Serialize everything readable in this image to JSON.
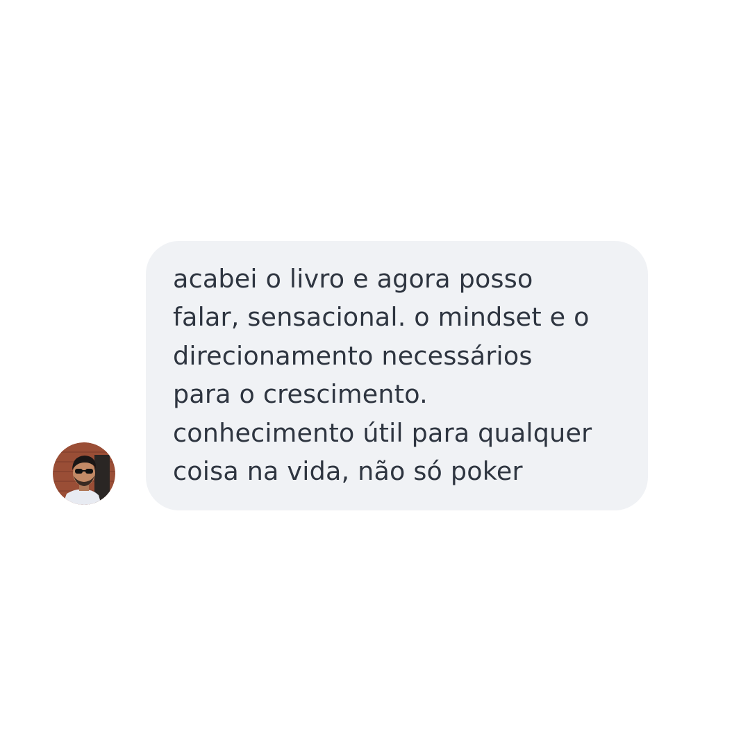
{
  "message": {
    "lines": [
      "acabei o livro e agora posso",
      "falar, sensacional. o mindset e o",
      "direcionamento necessários",
      "para o crescimento.",
      "conhecimento útil para qualquer",
      "coisa na vida, não só poker"
    ],
    "bubble_color": "#f0f2f5",
    "text_color": "#2e3540"
  },
  "avatar": {
    "icon": "user-avatar-photo"
  }
}
